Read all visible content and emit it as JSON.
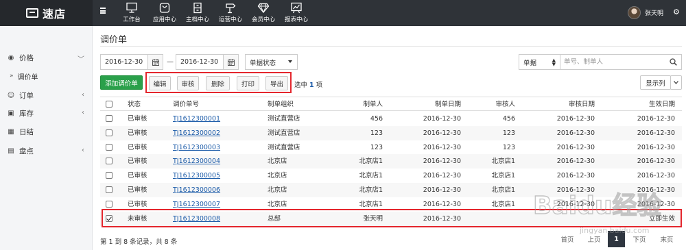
{
  "app": {
    "logo_text": "速店"
  },
  "topnav": [
    {
      "label": "工作台",
      "icon": "monitor-icon"
    },
    {
      "label": "应用中心",
      "icon": "bag-icon"
    },
    {
      "label": "主档中心",
      "icon": "file-cabinet-icon"
    },
    {
      "label": "运营中心",
      "icon": "signpost-icon"
    },
    {
      "label": "会员中心",
      "icon": "diamond-icon"
    },
    {
      "label": "报表中心",
      "icon": "chart-board-icon"
    }
  ],
  "user": {
    "name": "张天明"
  },
  "sidebar": {
    "items": [
      {
        "label": "价格",
        "icon": "coins-icon",
        "expanded": true
      },
      {
        "label": "订单",
        "icon": "person-icon"
      },
      {
        "label": "库存",
        "icon": "box-icon"
      },
      {
        "label": "日结",
        "icon": "calendar-icon"
      },
      {
        "label": "盘点",
        "icon": "clipboard-icon"
      }
    ],
    "sub_items": [
      {
        "label": "调价单"
      }
    ]
  },
  "page": {
    "title": "调价单"
  },
  "filters": {
    "date_from": "2016-12-30",
    "date_sep": "—",
    "date_to": "2016-12-30",
    "status_select": "单据状态",
    "doc_type_select": "单据",
    "search_placeholder": "单号、制单人"
  },
  "toolbar": {
    "add_label": "添加调价单",
    "edit_label": "编辑",
    "approve_label": "审核",
    "delete_label": "删除",
    "print_label": "打印",
    "export_label": "导出",
    "selected_prefix": "选中",
    "selected_count": "1",
    "selected_suffix": "项",
    "columns_label": "显示列"
  },
  "table": {
    "headers": [
      "状态",
      "调价单号",
      "制单组织",
      "制单人",
      "制单日期",
      "审核人",
      "审核日期",
      "生效日期"
    ],
    "rows": [
      {
        "checked": false,
        "status": "已审核",
        "no": "TJ1612300001",
        "org": "测试直营店",
        "maker": "456",
        "make_date": "2016-12-30",
        "reviewer": "456",
        "review_date": "2016-12-30",
        "effective": "2016-12-30"
      },
      {
        "checked": false,
        "status": "已审核",
        "no": "TJ1612300002",
        "org": "测试直营店",
        "maker": "123",
        "make_date": "2016-12-30",
        "reviewer": "123",
        "review_date": "2016-12-30",
        "effective": "2016-12-30"
      },
      {
        "checked": false,
        "status": "已审核",
        "no": "TJ1612300003",
        "org": "测试直营店",
        "maker": "123",
        "make_date": "2016-12-30",
        "reviewer": "123",
        "review_date": "2016-12-30",
        "effective": "2016-12-30"
      },
      {
        "checked": false,
        "status": "已审核",
        "no": "TJ1612300004",
        "org": "北京店",
        "maker": "北京店1",
        "make_date": "2016-12-30",
        "reviewer": "北京店1",
        "review_date": "2016-12-30",
        "effective": "2016-12-30"
      },
      {
        "checked": false,
        "status": "已审核",
        "no": "TJ1612300005",
        "org": "北京店",
        "maker": "北京店1",
        "make_date": "2016-12-30",
        "reviewer": "北京店1",
        "review_date": "2016-12-30",
        "effective": "2016-12-30"
      },
      {
        "checked": false,
        "status": "已审核",
        "no": "TJ1612300006",
        "org": "北京店",
        "maker": "北京店1",
        "make_date": "2016-12-30",
        "reviewer": "北京店1",
        "review_date": "2016-12-30",
        "effective": "2016-12-30"
      },
      {
        "checked": false,
        "status": "已审核",
        "no": "TJ1612300007",
        "org": "北京店",
        "maker": "北京店1",
        "make_date": "2016-12-30",
        "reviewer": "北京店1",
        "review_date": "2016-12-30",
        "effective": "2016-12-30"
      },
      {
        "checked": true,
        "status": "未审核",
        "no": "TJ1612300008",
        "org": "总部",
        "maker": "张天明",
        "make_date": "2016-12-30",
        "reviewer": "",
        "review_date": "",
        "effective": "立即生效"
      }
    ]
  },
  "footer": {
    "records_text": "第 1 到 8 条记录，共 8 条",
    "pager": {
      "first": "首页",
      "prev": "上页",
      "current": "1",
      "next": "下页",
      "last": "末页"
    }
  },
  "watermark": {
    "text": "Baidu经验",
    "sub": "jingyan.baidu.com"
  },
  "colors": {
    "topbar": "#2f3338",
    "primary_green": "#2aa04a",
    "link_blue": "#1a5aa8",
    "highlight_red": "#e4262d"
  }
}
